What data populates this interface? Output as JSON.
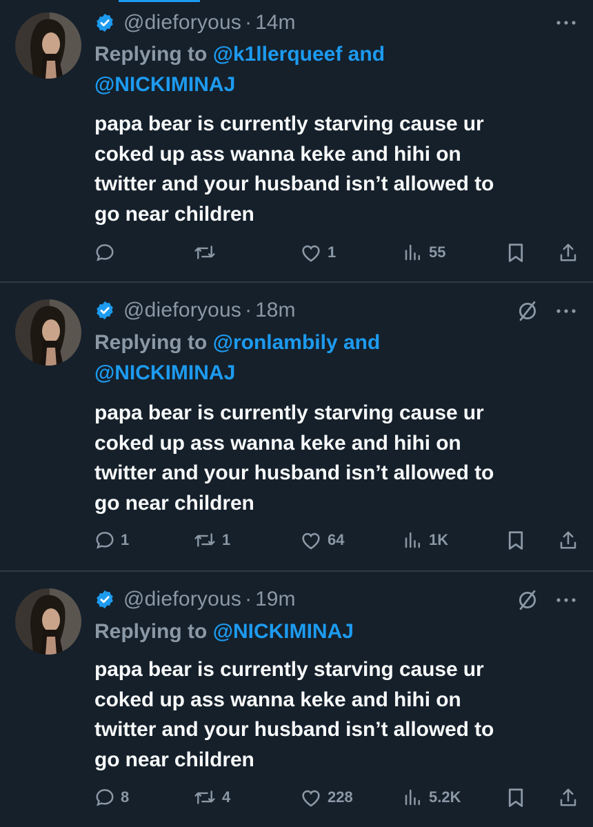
{
  "colors": {
    "background": "#15202b",
    "text": "#f7f9f9",
    "secondary": "#8b98a5",
    "accent": "#1d9bf0",
    "divider": "#2f3b47"
  },
  "tweets": [
    {
      "handle": "@dieforyous",
      "separator": "·",
      "time": "14m",
      "verified": true,
      "show_grok": false,
      "replying_prefix": "Replying to",
      "reply_mentions": "@k1llerqueef and",
      "reply_mentions_line2": "@NICKIMINAJ",
      "text_lines": [
        "papa bear is currently starving cause ur",
        "coked up ass wanna keke and hihi on",
        "twitter and your husband isn’t allowed to",
        "go near children"
      ],
      "replies": "",
      "retweets": "",
      "likes": "1",
      "views": "55",
      "icons": [
        "reply-icon",
        "retweet-icon",
        "like-icon",
        "views-icon",
        "bookmark-icon",
        "share-icon"
      ]
    },
    {
      "handle": "@dieforyous",
      "separator": "·",
      "time": "18m",
      "verified": true,
      "show_grok": true,
      "replying_prefix": "Replying to",
      "reply_mentions": "@ronlambily and",
      "reply_mentions_line2": "@NICKIMINAJ",
      "text_lines": [
        "papa bear is currently starving cause ur",
        "coked up ass wanna keke and hihi on",
        "twitter and your husband isn’t allowed to",
        "go near children"
      ],
      "replies": "1",
      "retweets": "1",
      "likes": "64",
      "views": "1K",
      "icons": [
        "reply-icon",
        "retweet-icon",
        "like-icon",
        "views-icon",
        "bookmark-icon",
        "share-icon"
      ]
    },
    {
      "handle": "@dieforyous",
      "separator": "·",
      "time": "19m",
      "verified": true,
      "show_grok": true,
      "replying_prefix": "Replying to",
      "reply_mentions": "@NICKIMINAJ",
      "reply_mentions_line2": "",
      "text_lines": [
        "papa bear is currently starving cause ur",
        "coked up ass wanna keke and hihi on",
        "twitter and your husband isn’t allowed to",
        "go near children"
      ],
      "replies": "8",
      "retweets": "4",
      "likes": "228",
      "views": "5.2K",
      "icons": [
        "reply-icon",
        "retweet-icon",
        "like-icon",
        "views-icon",
        "bookmark-icon",
        "share-icon"
      ]
    }
  ]
}
